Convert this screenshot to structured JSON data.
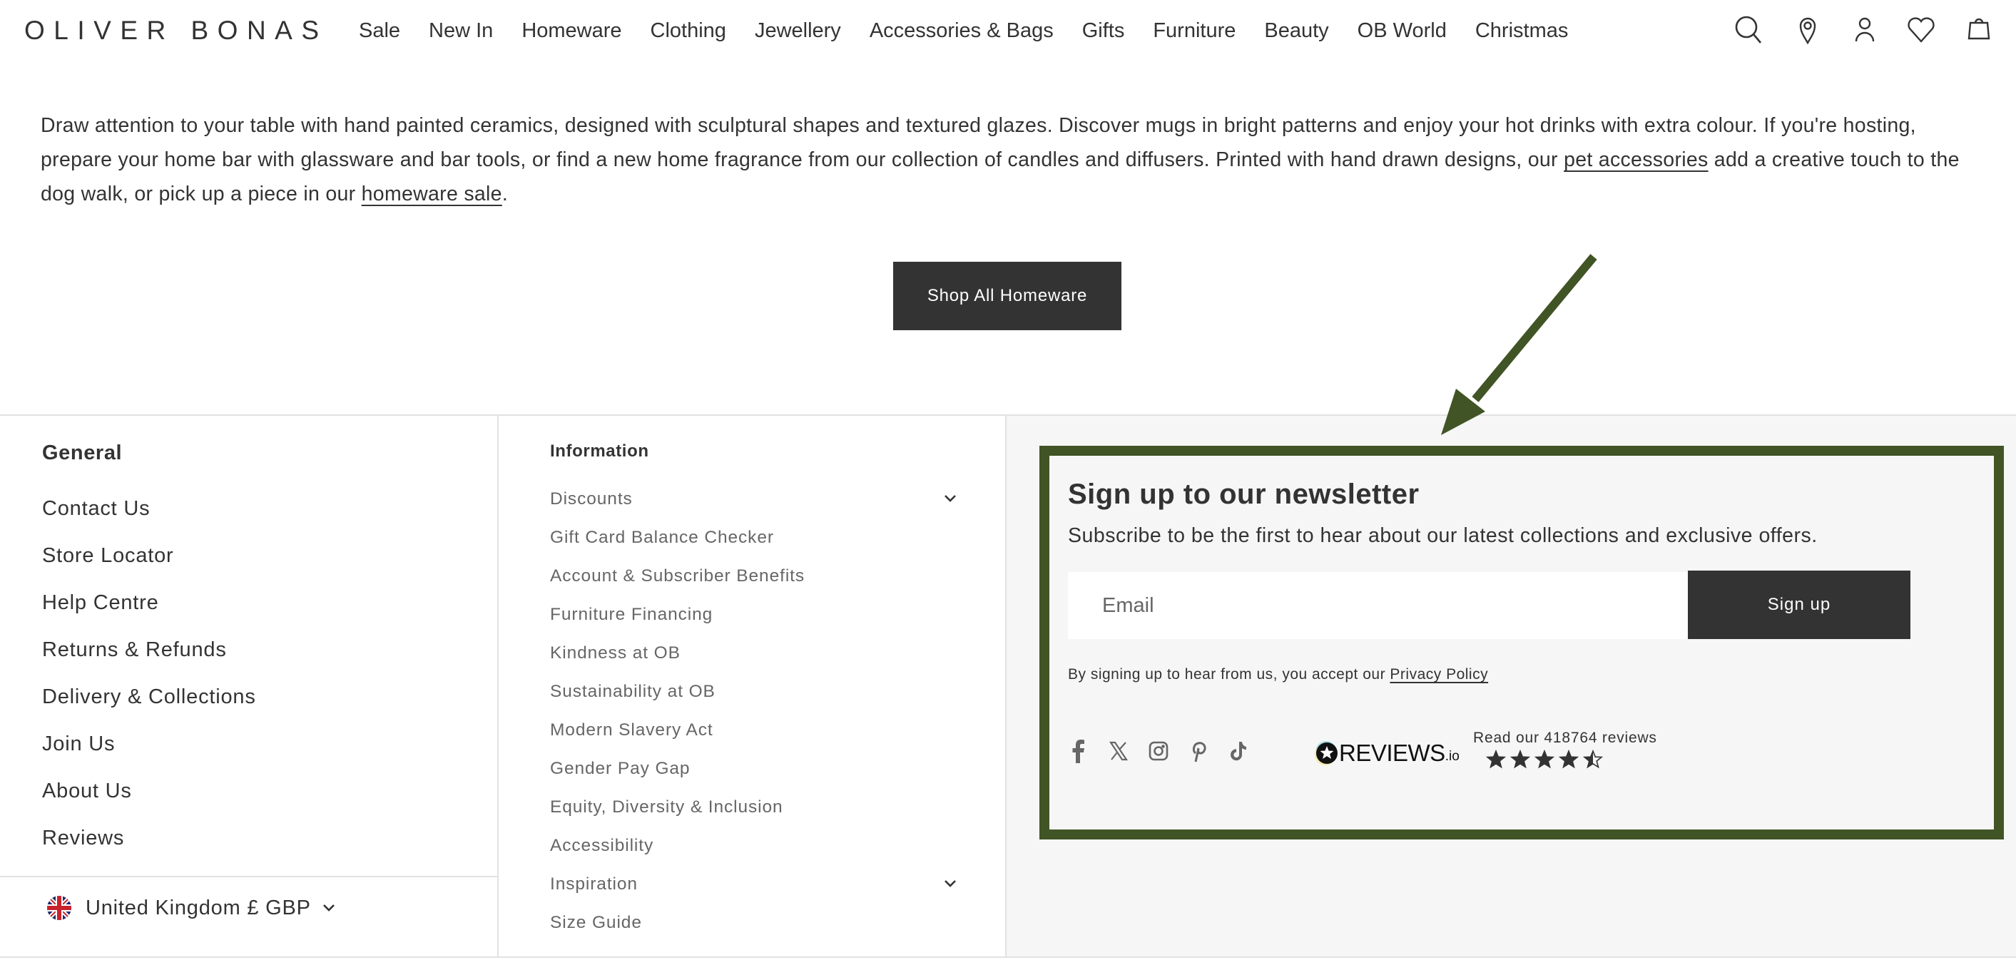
{
  "header": {
    "logo": "OLIVER BONAS",
    "nav": [
      "Sale",
      "New In",
      "Homeware",
      "Clothing",
      "Jewellery",
      "Accessories & Bags",
      "Gifts",
      "Furniture",
      "Beauty",
      "OB World",
      "Christmas"
    ],
    "icons": [
      "search-icon",
      "location-pin-icon",
      "account-icon",
      "wishlist-heart-icon",
      "shopping-bag-icon"
    ]
  },
  "description": {
    "part1": "Draw attention to your table with hand painted ceramics, designed with sculptural shapes and textured glazes. Discover mugs in bright patterns and enjoy your hot drinks with extra colour. If you're hosting, prepare your home bar with glassware and bar tools, or find a new home fragrance from our collection of candles and diffusers. Printed with hand drawn designs, our ",
    "link1": "pet accessories",
    "part2": " add a creative touch to the dog walk, or pick up a piece in our ",
    "link2": "homeware sale",
    "part3": "."
  },
  "shop_button": "Shop All Homeware",
  "footer": {
    "general": {
      "title": "General",
      "items": [
        "Contact Us",
        "Store Locator",
        "Help Centre",
        "Returns & Refunds",
        "Delivery & Collections",
        "Join Us",
        "About Us",
        "Reviews"
      ],
      "country": "United Kingdom £ GBP"
    },
    "information": {
      "title": "Information",
      "items": [
        {
          "label": "Discounts",
          "expandable": true
        },
        {
          "label": "Gift Card Balance Checker",
          "expandable": false
        },
        {
          "label": "Account & Subscriber Benefits",
          "expandable": false
        },
        {
          "label": "Furniture Financing",
          "expandable": false
        },
        {
          "label": "Kindness at OB",
          "expandable": false
        },
        {
          "label": "Sustainability at OB",
          "expandable": false
        },
        {
          "label": "Modern Slavery Act",
          "expandable": false
        },
        {
          "label": "Gender Pay Gap",
          "expandable": false
        },
        {
          "label": "Equity, Diversity & Inclusion",
          "expandable": false
        },
        {
          "label": "Accessibility",
          "expandable": false
        },
        {
          "label": "Inspiration",
          "expandable": true
        },
        {
          "label": "Size Guide",
          "expandable": false
        }
      ]
    },
    "newsletter": {
      "title": "Sign up to our newsletter",
      "subtitle": "Subscribe to be the first to hear about our latest collections and exclusive offers.",
      "email_placeholder": "Email",
      "email_value": "",
      "signup_label": "Sign up",
      "privacy_text": "By signing up to hear from us, you accept our ",
      "privacy_link": "Privacy Policy",
      "socials": [
        "facebook-icon",
        "x-twitter-icon",
        "instagram-icon",
        "pinterest-icon",
        "tiktok-icon"
      ],
      "reviews_logo_main": "REVIEWS",
      "reviews_logo_suffix": ".io",
      "reviews_text": "Read our 418764 reviews",
      "rating": 4.5,
      "rating_max": 5
    }
  },
  "colors": {
    "text": "#333333",
    "muted_text": "#666666",
    "button_bg": "#333333",
    "footer_panel_bg": "#f6f6f6",
    "annotation_green": "#415425",
    "divider": "#e2e2e2"
  },
  "annotation": {
    "type": "arrow-and-highlight-box",
    "target": "newsletter-signup"
  }
}
